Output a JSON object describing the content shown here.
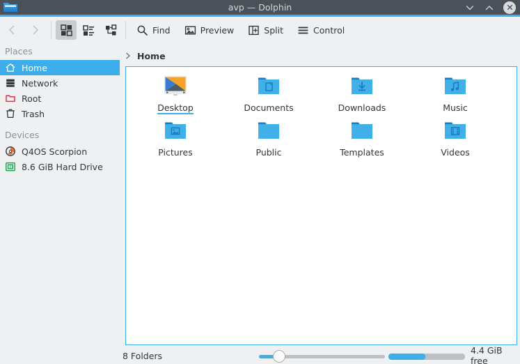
{
  "window": {
    "title": "avp — Dolphin",
    "app_icon": "dolphin-folder-icon",
    "controls": {
      "minimize": "chevron-down-icon",
      "maximize": "chevron-up-icon",
      "close": "close-circle-icon"
    },
    "titlebar_color": "#4b5158",
    "accent_color": "#3daee9"
  },
  "toolbar": {
    "back_label": "Back",
    "forward_label": "Forward",
    "view_modes": [
      {
        "name": "icons-view",
        "label": "Icons",
        "active": true
      },
      {
        "name": "details-view",
        "label": "Details",
        "active": false
      },
      {
        "name": "compact-view",
        "label": "Compact",
        "active": false
      }
    ],
    "actions": [
      {
        "icon": "search-icon",
        "label": "Find"
      },
      {
        "icon": "preview-image-icon",
        "label": "Preview"
      },
      {
        "icon": "split-view-icon",
        "label": "Split"
      },
      {
        "icon": "hamburger-menu-icon",
        "label": "Control"
      }
    ]
  },
  "sidebar": {
    "sections": [
      {
        "header": "Places",
        "items": [
          {
            "label": "Home",
            "icon": "home-icon",
            "selected": true
          },
          {
            "label": "Network",
            "icon": "network-icon",
            "selected": false
          },
          {
            "label": "Root",
            "icon": "root-folder-icon",
            "selected": false
          },
          {
            "label": "Trash",
            "icon": "trash-icon",
            "selected": false
          }
        ]
      },
      {
        "header": "Devices",
        "items": [
          {
            "label": "Q4OS Scorpion",
            "icon": "optical-disc-icon",
            "selected": false
          },
          {
            "label": "8.6 GiB Hard Drive",
            "icon": "hard-drive-icon",
            "selected": false
          }
        ]
      }
    ]
  },
  "breadcrumb": {
    "chevron": "chevron-right-icon",
    "current": "Home"
  },
  "files": [
    {
      "label": "Desktop",
      "icon": "desktop-wallpaper-icon",
      "hovered": true
    },
    {
      "label": "Documents",
      "icon": "folder-documents-icon",
      "hovered": false
    },
    {
      "label": "Downloads",
      "icon": "folder-downloads-icon",
      "hovered": false
    },
    {
      "label": "Music",
      "icon": "folder-music-icon",
      "hovered": false
    },
    {
      "label": "Pictures",
      "icon": "folder-pictures-icon",
      "hovered": false
    },
    {
      "label": "Public",
      "icon": "folder-plain-icon",
      "hovered": false
    },
    {
      "label": "Templates",
      "icon": "folder-plain-icon",
      "hovered": false
    },
    {
      "label": "Videos",
      "icon": "folder-videos-icon",
      "hovered": false
    }
  ],
  "statusbar": {
    "item_count": "8 Folders",
    "free_space": "4.4 GiB free",
    "zoom_percent": 16,
    "capacity_percent": 48
  }
}
